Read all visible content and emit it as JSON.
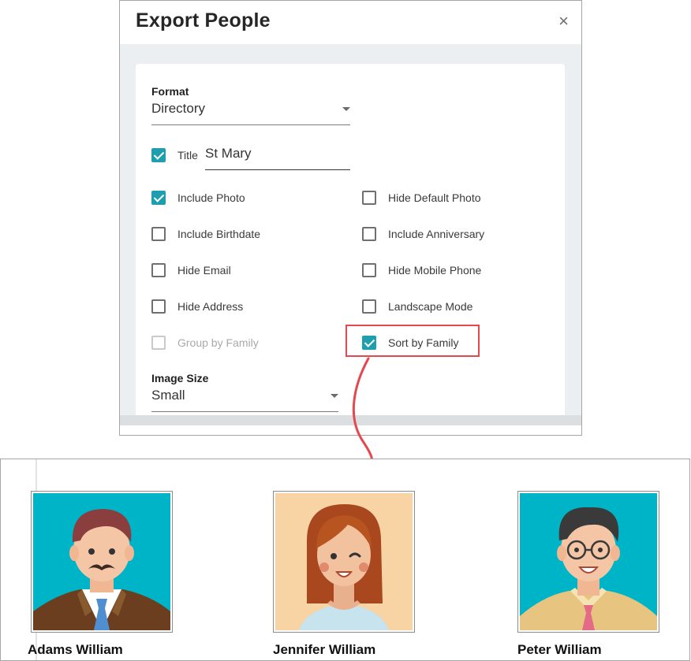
{
  "dialog": {
    "title": "Export People",
    "close_label": "×",
    "format": {
      "label": "Format",
      "value": "Directory"
    },
    "title_option": {
      "label": "Title",
      "checked": true,
      "value": "St Mary"
    },
    "options": [
      {
        "label": "Include Photo",
        "checked": true,
        "disabled": false
      },
      {
        "label": "Hide Default Photo",
        "checked": false,
        "disabled": false
      },
      {
        "label": "Include Birthdate",
        "checked": false,
        "disabled": false
      },
      {
        "label": "Include Anniversary",
        "checked": false,
        "disabled": false
      },
      {
        "label": "Hide Email",
        "checked": false,
        "disabled": false
      },
      {
        "label": "Hide Mobile Phone",
        "checked": false,
        "disabled": false
      },
      {
        "label": "Hide Address",
        "checked": false,
        "disabled": false
      },
      {
        "label": "Landscape Mode",
        "checked": false,
        "disabled": false
      },
      {
        "label": "Group by Family",
        "checked": false,
        "disabled": true
      },
      {
        "label": "Sort by Family",
        "checked": true,
        "disabled": false
      }
    ],
    "image_size": {
      "label": "Image Size",
      "value": "Small"
    }
  },
  "preview": {
    "people": [
      {
        "name": "Adams William",
        "photo": "man-mustache-avatar"
      },
      {
        "name": "Jennifer William",
        "photo": "woman-avatar"
      },
      {
        "name": "Peter William",
        "photo": "man-glasses-avatar"
      }
    ]
  },
  "colors": {
    "accent": "#1f9fad",
    "highlight": "#e5494f",
    "photo_teal": "#00b4c8",
    "photo_peach": "#f8d4a4"
  }
}
